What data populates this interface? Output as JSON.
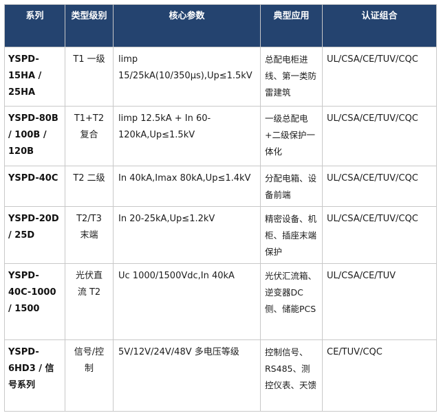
{
  "table": {
    "headers": {
      "series": "系列",
      "type": "类型级别",
      "params": "核心参数",
      "app": "典型应用",
      "cert": "认证组合"
    },
    "rows": [
      {
        "series": "YSPD-15HA / 25HA",
        "type": "T1 一级",
        "params": "limp 15/25kA(10/350μs),Up≤1.5kV",
        "app": "总配电柜进线、第一类防雷建筑",
        "cert": "UL/CSA/CE/TUV/CQC"
      },
      {
        "series": "YSPD-80B / 100B / 120B",
        "type": "T1+T2复合",
        "params": "limp 12.5kA + In 60-120kA,Up≤1.5kV",
        "app": "一级总配电+二级保护一体化",
        "cert": "UL/CSA/CE/TUV/CQC"
      },
      {
        "series": "YSPD-40C",
        "type": "T2 二级",
        "params": "In 40kA,Imax 80kA,Up≤1.4kV",
        "app": "分配电箱、设备前端",
        "cert": "UL/CSA/CE/TUV/CQC"
      },
      {
        "series": "YSPD-20D / 25D",
        "type": "T2/T3末端",
        "params": "In 20-25kA,Up≤1.2kV",
        "app": "精密设备、机柜、插座末端保护",
        "cert": "UL/CSA/CE/TUV/CQC"
      },
      {
        "series": "YSPD-40C-1000 / 1500",
        "type": "光伏直流 T2",
        "params": "Uc 1000/1500Vdc,In 40kA",
        "app": "光伏汇流箱、逆变器DC侧、储能PCS",
        "cert": "UL/CSA/CE/TUV"
      },
      {
        "series": "YSPD-6HD3 / 信号系列",
        "type": "信号/控制",
        "params": "5V/12V/24V/48V 多电压等级",
        "app": "控制信号、RS485、测控仪表、天馈",
        "cert": "CE/TUV/CQC"
      }
    ]
  }
}
